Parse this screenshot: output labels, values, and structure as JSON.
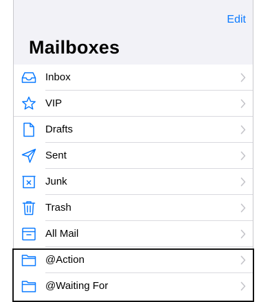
{
  "header": {
    "edit_label": "Edit",
    "title": "Mailboxes"
  },
  "mailboxes": [
    {
      "label": "Inbox",
      "icon": "inbox-icon"
    },
    {
      "label": "VIP",
      "icon": "star-icon"
    },
    {
      "label": "Drafts",
      "icon": "document-icon"
    },
    {
      "label": "Sent",
      "icon": "paper-plane-icon"
    },
    {
      "label": "Junk",
      "icon": "junk-bin-icon"
    },
    {
      "label": "Trash",
      "icon": "trash-icon"
    },
    {
      "label": "All Mail",
      "icon": "archive-box-icon"
    },
    {
      "label": "@Action",
      "icon": "folder-icon"
    },
    {
      "label": "@Waiting For",
      "icon": "folder-icon"
    }
  ],
  "colors": {
    "accent": "#0a7aff",
    "background": "#f2f2f7",
    "separator": "#d9d9de",
    "chevron": "#c4c4c9"
  }
}
